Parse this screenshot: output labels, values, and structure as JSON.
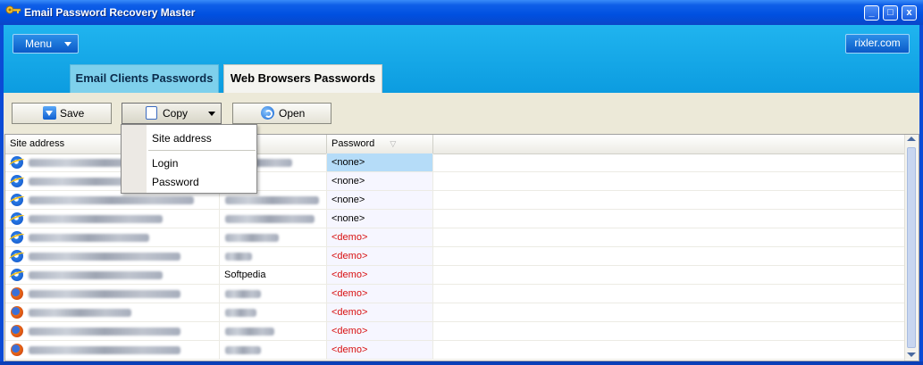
{
  "window": {
    "title": "Email Password Recovery Master"
  },
  "header": {
    "menu_label": "Menu",
    "site_link": "rixler.com"
  },
  "tabs": [
    {
      "label": "Email Clients Passwords",
      "active": false
    },
    {
      "label": "Web Browsers Passwords",
      "active": true
    }
  ],
  "toolbar": {
    "save_label": "Save",
    "copy_label": "Copy",
    "open_label": "Open"
  },
  "grid": {
    "columns": [
      "Site address",
      "",
      "Password"
    ],
    "rows": [
      {
        "browser": "ie-icon",
        "login": "",
        "password": "<none>",
        "selected": true
      },
      {
        "browser": "ie-icon",
        "login": "",
        "password": "<none>"
      },
      {
        "browser": "ie-icon",
        "login": "",
        "password": "<none>"
      },
      {
        "browser": "ie-icon",
        "login": "",
        "password": "<none>"
      },
      {
        "browser": "ie-icon",
        "login": "",
        "password": "<demo>"
      },
      {
        "browser": "ie-icon",
        "login": "",
        "password": "<demo>"
      },
      {
        "browser": "ie-icon",
        "login": "Softpedia",
        "password": "<demo>"
      },
      {
        "browser": "firefox-icon",
        "login": "",
        "password": "<demo>"
      },
      {
        "browser": "firefox-icon",
        "login": "",
        "password": "<demo>"
      },
      {
        "browser": "firefox-icon",
        "login": "",
        "password": "<demo>"
      },
      {
        "browser": "firefox-icon",
        "login": "",
        "password": "<demo>"
      }
    ]
  },
  "copy_menu": {
    "items": [
      "Site address",
      "Login",
      "Password"
    ]
  },
  "colors": {
    "demo_text": "#d81010",
    "selection": "#b5dcf8",
    "header_blue": "#20b4ef"
  }
}
